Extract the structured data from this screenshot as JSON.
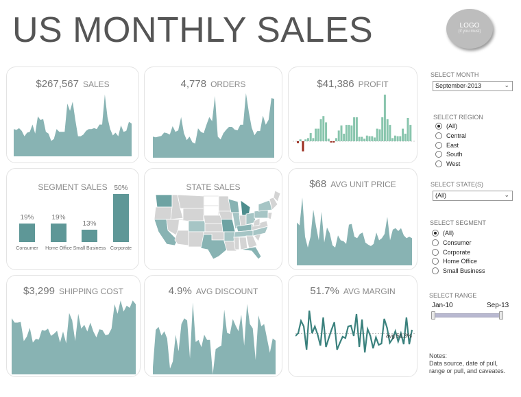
{
  "header": {
    "title": "US MONTHLY SALES",
    "logo_line1": "LOGO",
    "logo_line2": "(if you must)"
  },
  "colors": {
    "area": "#88b3b3",
    "profit_pos": "#88c5ad",
    "profit_neg": "#9b2d1f",
    "line": "#3a817d",
    "segment_bar": "#5e9797"
  },
  "cards": {
    "sales": {
      "value": "$267,567",
      "label": "SALES"
    },
    "orders": {
      "value": "4,778",
      "label": "ORDERS"
    },
    "profit": {
      "value": "$41,386",
      "label": "PROFIT"
    },
    "segment": {
      "title": "SEGMENT SALES"
    },
    "state": {
      "title": "STATE SALES"
    },
    "unit_price": {
      "value": "$68",
      "label": "AVG UNIT PRICE"
    },
    "shipping": {
      "value": "$3,299",
      "label": "SHIPPING COST"
    },
    "discount": {
      "value": "4.9%",
      "label": "AVG DISCOUNT"
    },
    "margin": {
      "value": "51.7%",
      "label": "AVG MARGIN",
      "avg_label": "avg 51.3%"
    }
  },
  "filters": {
    "month": {
      "label": "SELECT MONTH",
      "value": "September-2013"
    },
    "region": {
      "label": "SELECT REGION",
      "options": [
        "(All)",
        "Central",
        "East",
        "South",
        "West"
      ],
      "selected": 0
    },
    "states": {
      "label": "SELECT STATE(S)",
      "value": "(All)"
    },
    "segment": {
      "label": "SELECT SEGMENT",
      "options": [
        "(All)",
        "Consumer",
        "Corporate",
        "Home Office",
        "Small Business"
      ],
      "selected": 0
    },
    "range": {
      "label": "SELECT RANGE",
      "start": "Jan-10",
      "end": "Sep-13"
    }
  },
  "notes": {
    "title": "Notes:",
    "line1": "Data source, date of pull,",
    "line2": "range or pull, and caveates."
  },
  "chart_data": [
    {
      "type": "area",
      "name": "sales",
      "values": [
        30,
        29,
        31,
        28,
        22,
        26,
        27,
        35,
        25,
        44,
        40,
        41,
        27,
        25,
        17,
        19,
        30,
        27,
        27,
        27,
        58,
        50,
        60,
        40,
        22,
        22,
        24,
        28,
        30,
        30,
        31,
        30,
        35,
        35,
        68,
        43,
        30,
        23,
        26,
        22,
        34,
        27,
        28,
        38,
        36
      ]
    },
    {
      "type": "area",
      "name": "orders",
      "values": [
        30,
        29,
        30,
        31,
        36,
        35,
        33,
        45,
        37,
        39,
        58,
        35,
        25,
        30,
        22,
        20,
        42,
        37,
        35,
        47,
        58,
        52,
        88,
        30,
        26,
        35,
        40,
        44,
        44,
        40,
        39,
        47,
        47,
        92,
        65,
        43,
        32,
        38,
        38,
        60,
        47,
        54,
        85,
        84
      ]
    },
    {
      "type": "bar",
      "name": "profit",
      "values": [
        -3,
        3,
        -16,
        3,
        5,
        13,
        5,
        20,
        20,
        35,
        40,
        30,
        4,
        -2,
        -2,
        5,
        17,
        25,
        12,
        26,
        26,
        25,
        38,
        38,
        7,
        7,
        4,
        9,
        8,
        8,
        6,
        20,
        19,
        38,
        74,
        35,
        26,
        5,
        9,
        8,
        8,
        20,
        12,
        37,
        26
      ]
    },
    {
      "type": "bar",
      "name": "segment_sales",
      "categories": [
        "Consumer",
        "Home Office",
        "Small Business",
        "Corporate"
      ],
      "values": [
        19,
        19,
        13,
        50
      ],
      "labels": [
        "19%",
        "19%",
        "13%",
        "50%"
      ]
    },
    {
      "type": "area",
      "name": "avg_unit_price",
      "values": [
        60,
        56,
        95,
        40,
        25,
        40,
        78,
        55,
        35,
        75,
        32,
        53,
        45,
        28,
        25,
        42,
        35,
        34,
        30,
        57,
        58,
        40,
        38,
        44,
        46,
        32,
        29,
        27,
        30,
        46,
        35,
        38,
        44,
        68,
        35,
        50,
        52,
        48,
        52,
        42,
        38,
        40,
        38
      ]
    },
    {
      "type": "area",
      "name": "shipping_cost",
      "values": [
        76,
        70,
        70,
        71,
        45,
        51,
        63,
        43,
        48,
        47,
        60,
        59,
        62,
        52,
        55,
        59,
        43,
        58,
        42,
        83,
        73,
        45,
        82,
        62,
        67,
        58,
        70,
        58,
        50,
        61,
        60,
        53,
        54,
        62,
        95,
        82,
        100,
        85,
        93,
        90,
        100,
        95
      ]
    },
    {
      "type": "area",
      "name": "avg_discount",
      "values": [
        10,
        62,
        66,
        54,
        60,
        50,
        8,
        18,
        55,
        32,
        70,
        78,
        75,
        22,
        100,
        45,
        48,
        38,
        55,
        48,
        48,
        0,
        35,
        38,
        40,
        90,
        58,
        56,
        77,
        68,
        60,
        83,
        40,
        98,
        70,
        64,
        20,
        82,
        67,
        70,
        50,
        30,
        50,
        47
      ]
    },
    {
      "type": "line",
      "name": "avg_margin",
      "avg": 51.3,
      "values": [
        48,
        52,
        70,
        62,
        28,
        85,
        52,
        62,
        50,
        34,
        75,
        32,
        45,
        57,
        68,
        28,
        38,
        47,
        45,
        62,
        63,
        48,
        80,
        32,
        72,
        24,
        58,
        48,
        30,
        46,
        35,
        37,
        73,
        60,
        38,
        44,
        55,
        40,
        52,
        36,
        75,
        36,
        57
      ]
    }
  ]
}
